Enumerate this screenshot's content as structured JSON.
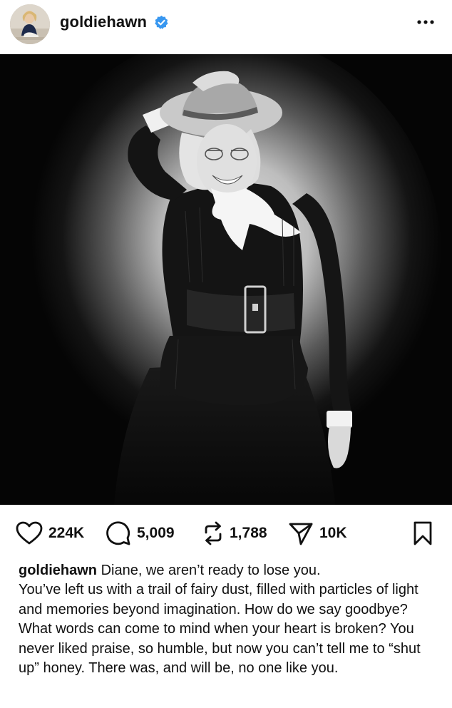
{
  "header": {
    "username": "goldiehawn",
    "verified_color": "#3897f0"
  },
  "post": {
    "image_icon": "portrait-photo"
  },
  "actions": {
    "likes": "224K",
    "comments": "5,009",
    "reposts": "1,788",
    "shares": "10K"
  },
  "caption": {
    "username": "goldiehawn",
    "first_line": "Diane, we aren’t ready to lose you.",
    "body": "You’ve left us with a trail of fairy dust, filled with particles of light and memories beyond imagination. How do we say goodbye? What words can come to mind when your heart is broken? You never liked praise, so humble, but now you can’t tell me to “shut up” honey. There was, and will be, no one like you."
  }
}
